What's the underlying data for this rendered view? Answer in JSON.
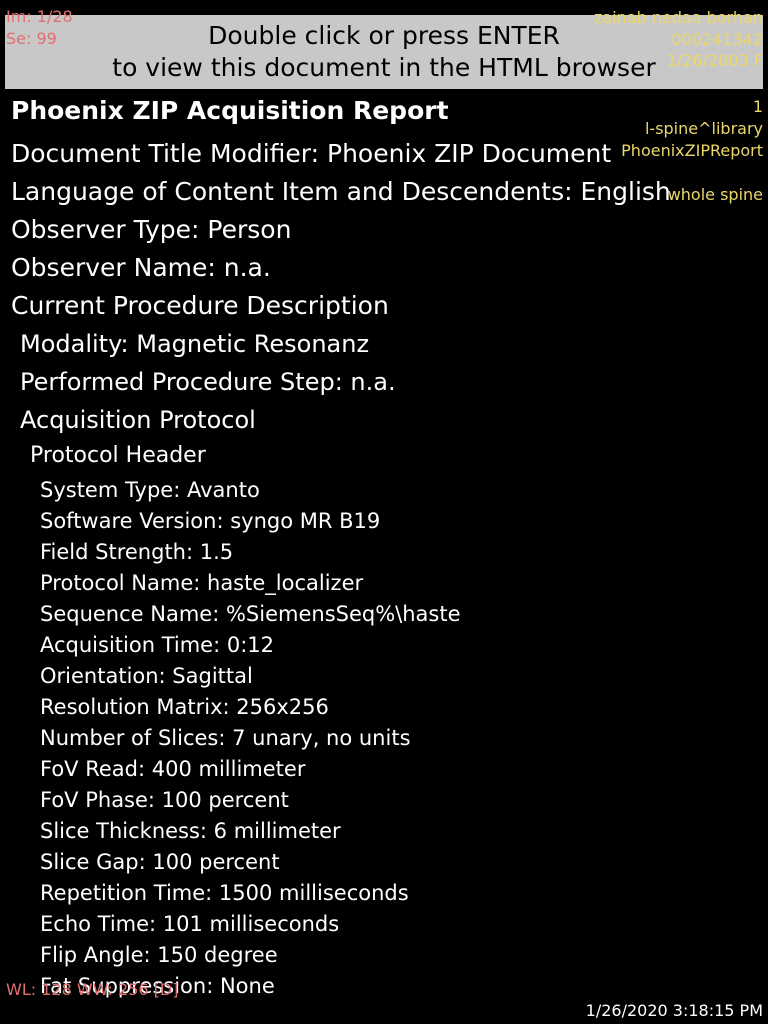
{
  "overlay": {
    "top_left": [
      "Im: 1/28",
      "Se: 99"
    ],
    "top_right": [
      "zainab nedaa borhan",
      "000241342",
      "1/26/2003 F",
      "1",
      "l-spine^library",
      "PhoenixZIPReport",
      "whole spine"
    ],
    "bottom_left": "WL: 128 WW: 256 [D]",
    "bottom_right": "1/26/2020 3:18:15 PM"
  },
  "banner": {
    "line1": "Double click or press ENTER",
    "line2": "to view this document in the HTML browser"
  },
  "report": {
    "title": "Phoenix ZIP Acquisition Report",
    "title_modifier": "Document Title Modifier: Phoenix ZIP Document",
    "language": "Language of Content Item and Descendents: English",
    "observer_type": "Observer Type: Person",
    "observer_name": "Observer Name: n.a.",
    "procedure_heading": "Current Procedure Description",
    "modality": "Modality: Magnetic Resonanz",
    "performed_step": "Performed Procedure Step: n.a.",
    "protocol_heading": "Acquisition Protocol",
    "protocol_header": "Protocol Header",
    "fields": [
      "System Type: Avanto",
      "Software Version: syngo MR B19",
      "Field Strength: 1.5",
      "Protocol Name: haste_localizer",
      "Sequence Name: %SiemensSeq%\\haste",
      "Acquisition Time: 0:12",
      "Orientation: Sagittal",
      "Resolution Matrix: 256x256",
      "Number of Slices: 7 unary, no units",
      "FoV Read: 400 millimeter",
      "FoV Phase: 100 percent",
      "Slice Thickness: 6 millimeter",
      "Slice Gap: 100 percent",
      "Repetition Time: 1500 milliseconds",
      "Echo Time: 101 milliseconds",
      "Flip Angle: 150 degree",
      "Fat Suppression: None"
    ]
  },
  "colors": {
    "background": "#000000",
    "banner": "#c8c8c8",
    "overlay_left": "#e07070",
    "overlay_right": "#ecd76a"
  }
}
